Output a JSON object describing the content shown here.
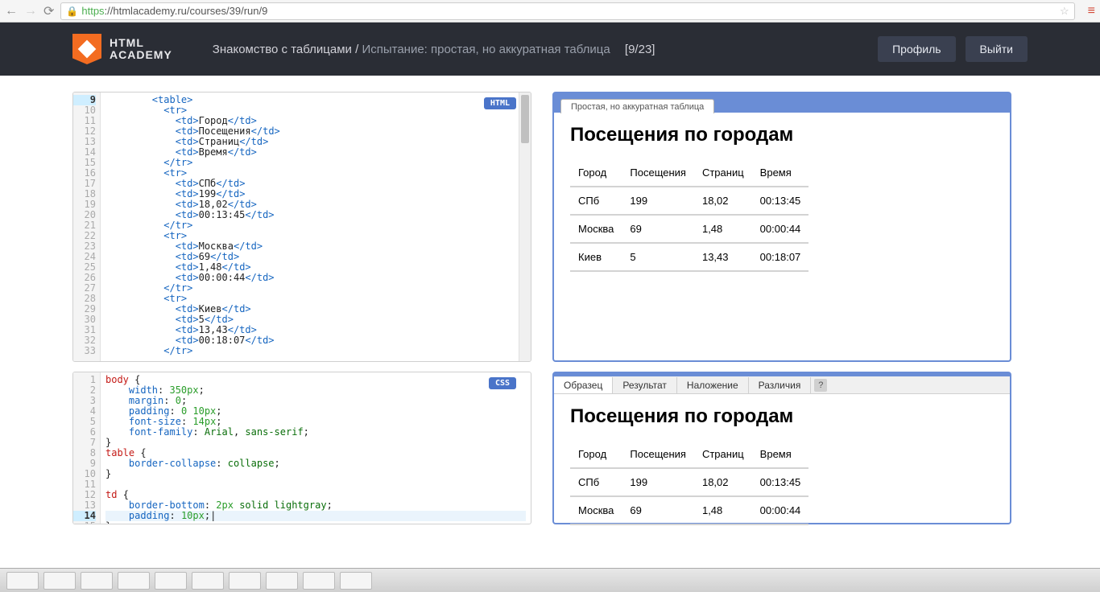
{
  "browser": {
    "url_https": "https",
    "url_rest": "://htmlacademy.ru/courses/39/run/9"
  },
  "header": {
    "logo_line1": "HTML",
    "logo_line2": "ACADEMY",
    "breadcrumb_course": "Знакомство с таблицами /",
    "breadcrumb_task": " Испытание: простая, но аккуратная таблица",
    "progress": "[9/23]",
    "profile_btn": "Профиль",
    "logout_btn": "Выйти"
  },
  "editors": {
    "html_badge": "HTML",
    "css_badge": "CSS",
    "html_start_line": 9,
    "html_lines": [
      {
        "indent": 8,
        "parts": [
          {
            "t": "tag",
            "v": "<table>"
          }
        ]
      },
      {
        "indent": 10,
        "parts": [
          {
            "t": "tag",
            "v": "<tr>"
          }
        ]
      },
      {
        "indent": 12,
        "parts": [
          {
            "t": "tag",
            "v": "<td>"
          },
          {
            "t": "txt",
            "v": "Город"
          },
          {
            "t": "tag",
            "v": "</td>"
          }
        ]
      },
      {
        "indent": 12,
        "parts": [
          {
            "t": "tag",
            "v": "<td>"
          },
          {
            "t": "txt",
            "v": "Посещения"
          },
          {
            "t": "tag",
            "v": "</td>"
          }
        ]
      },
      {
        "indent": 12,
        "parts": [
          {
            "t": "tag",
            "v": "<td>"
          },
          {
            "t": "txt",
            "v": "Страниц"
          },
          {
            "t": "tag",
            "v": "</td>"
          }
        ]
      },
      {
        "indent": 12,
        "parts": [
          {
            "t": "tag",
            "v": "<td>"
          },
          {
            "t": "txt",
            "v": "Время"
          },
          {
            "t": "tag",
            "v": "</td>"
          }
        ]
      },
      {
        "indent": 10,
        "parts": [
          {
            "t": "tag",
            "v": "</tr>"
          }
        ]
      },
      {
        "indent": 10,
        "parts": [
          {
            "t": "tag",
            "v": "<tr>"
          }
        ]
      },
      {
        "indent": 12,
        "parts": [
          {
            "t": "tag",
            "v": "<td>"
          },
          {
            "t": "txt",
            "v": "СПб"
          },
          {
            "t": "tag",
            "v": "</td>"
          }
        ]
      },
      {
        "indent": 12,
        "parts": [
          {
            "t": "tag",
            "v": "<td>"
          },
          {
            "t": "txt",
            "v": "199"
          },
          {
            "t": "tag",
            "v": "</td>"
          }
        ]
      },
      {
        "indent": 12,
        "parts": [
          {
            "t": "tag",
            "v": "<td>"
          },
          {
            "t": "txt",
            "v": "18,02"
          },
          {
            "t": "tag",
            "v": "</td>"
          }
        ]
      },
      {
        "indent": 12,
        "parts": [
          {
            "t": "tag",
            "v": "<td>"
          },
          {
            "t": "txt",
            "v": "00:13:45"
          },
          {
            "t": "tag",
            "v": "</td>"
          }
        ]
      },
      {
        "indent": 10,
        "parts": [
          {
            "t": "tag",
            "v": "</tr>"
          }
        ]
      },
      {
        "indent": 10,
        "parts": [
          {
            "t": "tag",
            "v": "<tr>"
          }
        ]
      },
      {
        "indent": 12,
        "parts": [
          {
            "t": "tag",
            "v": "<td>"
          },
          {
            "t": "txt",
            "v": "Москва"
          },
          {
            "t": "tag",
            "v": "</td>"
          }
        ]
      },
      {
        "indent": 12,
        "parts": [
          {
            "t": "tag",
            "v": "<td>"
          },
          {
            "t": "txt",
            "v": "69"
          },
          {
            "t": "tag",
            "v": "</td>"
          }
        ]
      },
      {
        "indent": 12,
        "parts": [
          {
            "t": "tag",
            "v": "<td>"
          },
          {
            "t": "txt",
            "v": "1,48"
          },
          {
            "t": "tag",
            "v": "</td>"
          }
        ]
      },
      {
        "indent": 12,
        "parts": [
          {
            "t": "tag",
            "v": "<td>"
          },
          {
            "t": "txt",
            "v": "00:00:44"
          },
          {
            "t": "tag",
            "v": "</td>"
          }
        ]
      },
      {
        "indent": 10,
        "parts": [
          {
            "t": "tag",
            "v": "</tr>"
          }
        ]
      },
      {
        "indent": 10,
        "parts": [
          {
            "t": "tag",
            "v": "<tr>"
          }
        ]
      },
      {
        "indent": 12,
        "parts": [
          {
            "t": "tag",
            "v": "<td>"
          },
          {
            "t": "txt",
            "v": "Киев"
          },
          {
            "t": "tag",
            "v": "</td>"
          }
        ]
      },
      {
        "indent": 12,
        "parts": [
          {
            "t": "tag",
            "v": "<td>"
          },
          {
            "t": "txt",
            "v": "5"
          },
          {
            "t": "tag",
            "v": "</td>"
          }
        ]
      },
      {
        "indent": 12,
        "parts": [
          {
            "t": "tag",
            "v": "<td>"
          },
          {
            "t": "txt",
            "v": "13,43"
          },
          {
            "t": "tag",
            "v": "</td>"
          }
        ]
      },
      {
        "indent": 12,
        "parts": [
          {
            "t": "tag",
            "v": "<td>"
          },
          {
            "t": "txt",
            "v": "00:18:07"
          },
          {
            "t": "tag",
            "v": "</td>"
          }
        ]
      },
      {
        "indent": 10,
        "parts": [
          {
            "t": "tag",
            "v": "</tr>"
          }
        ]
      }
    ],
    "css_start_line": 1,
    "css_active_line": 14,
    "css_lines": [
      {
        "parts": [
          {
            "t": "sel",
            "v": "body "
          },
          {
            "t": "txt",
            "v": "{"
          }
        ]
      },
      {
        "parts": [
          {
            "t": "txt",
            "v": "    "
          },
          {
            "t": "prop",
            "v": "width"
          },
          {
            "t": "txt",
            "v": ": "
          },
          {
            "t": "num",
            "v": "350px"
          },
          {
            "t": "txt",
            "v": ";"
          }
        ]
      },
      {
        "parts": [
          {
            "t": "txt",
            "v": "    "
          },
          {
            "t": "prop",
            "v": "margin"
          },
          {
            "t": "txt",
            "v": ": "
          },
          {
            "t": "num",
            "v": "0"
          },
          {
            "t": "txt",
            "v": ";"
          }
        ]
      },
      {
        "parts": [
          {
            "t": "txt",
            "v": "    "
          },
          {
            "t": "prop",
            "v": "padding"
          },
          {
            "t": "txt",
            "v": ": "
          },
          {
            "t": "num",
            "v": "0 10px"
          },
          {
            "t": "txt",
            "v": ";"
          }
        ]
      },
      {
        "parts": [
          {
            "t": "txt",
            "v": "    "
          },
          {
            "t": "prop",
            "v": "font-size"
          },
          {
            "t": "txt",
            "v": ": "
          },
          {
            "t": "num",
            "v": "14px"
          },
          {
            "t": "txt",
            "v": ";"
          }
        ]
      },
      {
        "parts": [
          {
            "t": "txt",
            "v": "    "
          },
          {
            "t": "prop",
            "v": "font-family"
          },
          {
            "t": "txt",
            "v": ": "
          },
          {
            "t": "kw",
            "v": "Arial"
          },
          {
            "t": "txt",
            "v": ", "
          },
          {
            "t": "kw",
            "v": "sans-serif"
          },
          {
            "t": "txt",
            "v": ";"
          }
        ]
      },
      {
        "parts": [
          {
            "t": "txt",
            "v": "}"
          }
        ]
      },
      {
        "parts": [
          {
            "t": "sel",
            "v": "table "
          },
          {
            "t": "txt",
            "v": "{"
          }
        ]
      },
      {
        "parts": [
          {
            "t": "txt",
            "v": "    "
          },
          {
            "t": "prop",
            "v": "border-collapse"
          },
          {
            "t": "txt",
            "v": ": "
          },
          {
            "t": "kw",
            "v": "collapse"
          },
          {
            "t": "txt",
            "v": ";"
          }
        ]
      },
      {
        "parts": [
          {
            "t": "txt",
            "v": "}"
          }
        ]
      },
      {
        "parts": []
      },
      {
        "parts": [
          {
            "t": "sel",
            "v": "td "
          },
          {
            "t": "txt",
            "v": "{"
          }
        ]
      },
      {
        "parts": [
          {
            "t": "txt",
            "v": "    "
          },
          {
            "t": "prop",
            "v": "border-bottom"
          },
          {
            "t": "txt",
            "v": ": "
          },
          {
            "t": "num",
            "v": "2px "
          },
          {
            "t": "kw",
            "v": "solid lightgray"
          },
          {
            "t": "txt",
            "v": ";"
          }
        ]
      },
      {
        "parts": [
          {
            "t": "txt",
            "v": "    "
          },
          {
            "t": "prop",
            "v": "padding"
          },
          {
            "t": "txt",
            "v": ": "
          },
          {
            "t": "num",
            "v": "10px"
          },
          {
            "t": "txt",
            "v": ";|"
          }
        ]
      },
      {
        "parts": [
          {
            "t": "txt",
            "v": "}"
          }
        ]
      }
    ]
  },
  "preview": {
    "tab_label": "Простая, но аккуратная таблица",
    "heading": "Посещения по городам",
    "table": {
      "headers": [
        "Город",
        "Посещения",
        "Страниц",
        "Время"
      ],
      "rows": [
        [
          "СПб",
          "199",
          "18,02",
          "00:13:45"
        ],
        [
          "Москва",
          "69",
          "1,48",
          "00:00:44"
        ],
        [
          "Киев",
          "5",
          "13,43",
          "00:18:07"
        ]
      ]
    },
    "lower_tabs": [
      "Образец",
      "Результат",
      "Наложение",
      "Различия"
    ],
    "lower_active": 0,
    "help": "?"
  }
}
